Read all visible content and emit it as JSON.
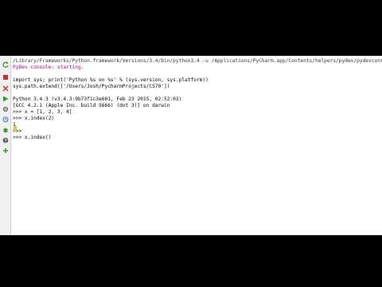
{
  "console": {
    "lines": [
      "/Library/Frameworks/Python.framework/Versions/3.4/bin/python3.4 -u /Applications/PyCharm.app/Contents/helpers/pydev/pydevconsole",
      "PyDev console: starting.",
      "",
      "import sys; print('Python %s on %s' % (sys.version, sys.platform))",
      "sys.path.extend(['/Users/Josh/PycharmProjects/CS70'])",
      "",
      "Python 3.4.3 (v3.4.3:9b73f1c3e601, Feb 23 2015, 02:52:03)",
      "[GCC 4.2.1 (Apple Inc. build 5666) (dot 3)] on darwin",
      ">>> x = [1, 2, 3, 4]",
      ">>> x.index(2)",
      "1",
      ">>> ",
      ">>> x.index()"
    ]
  },
  "icons": [
    "rerun-icon",
    "stop-icon",
    "close-icon",
    "execute-icon",
    "settings-icon",
    "history-icon",
    "debug-icon",
    "help-icon",
    "add-icon"
  ],
  "colors": {
    "magenta": "#b0008a",
    "background": "#ffffff",
    "letterbox": "#000000"
  }
}
